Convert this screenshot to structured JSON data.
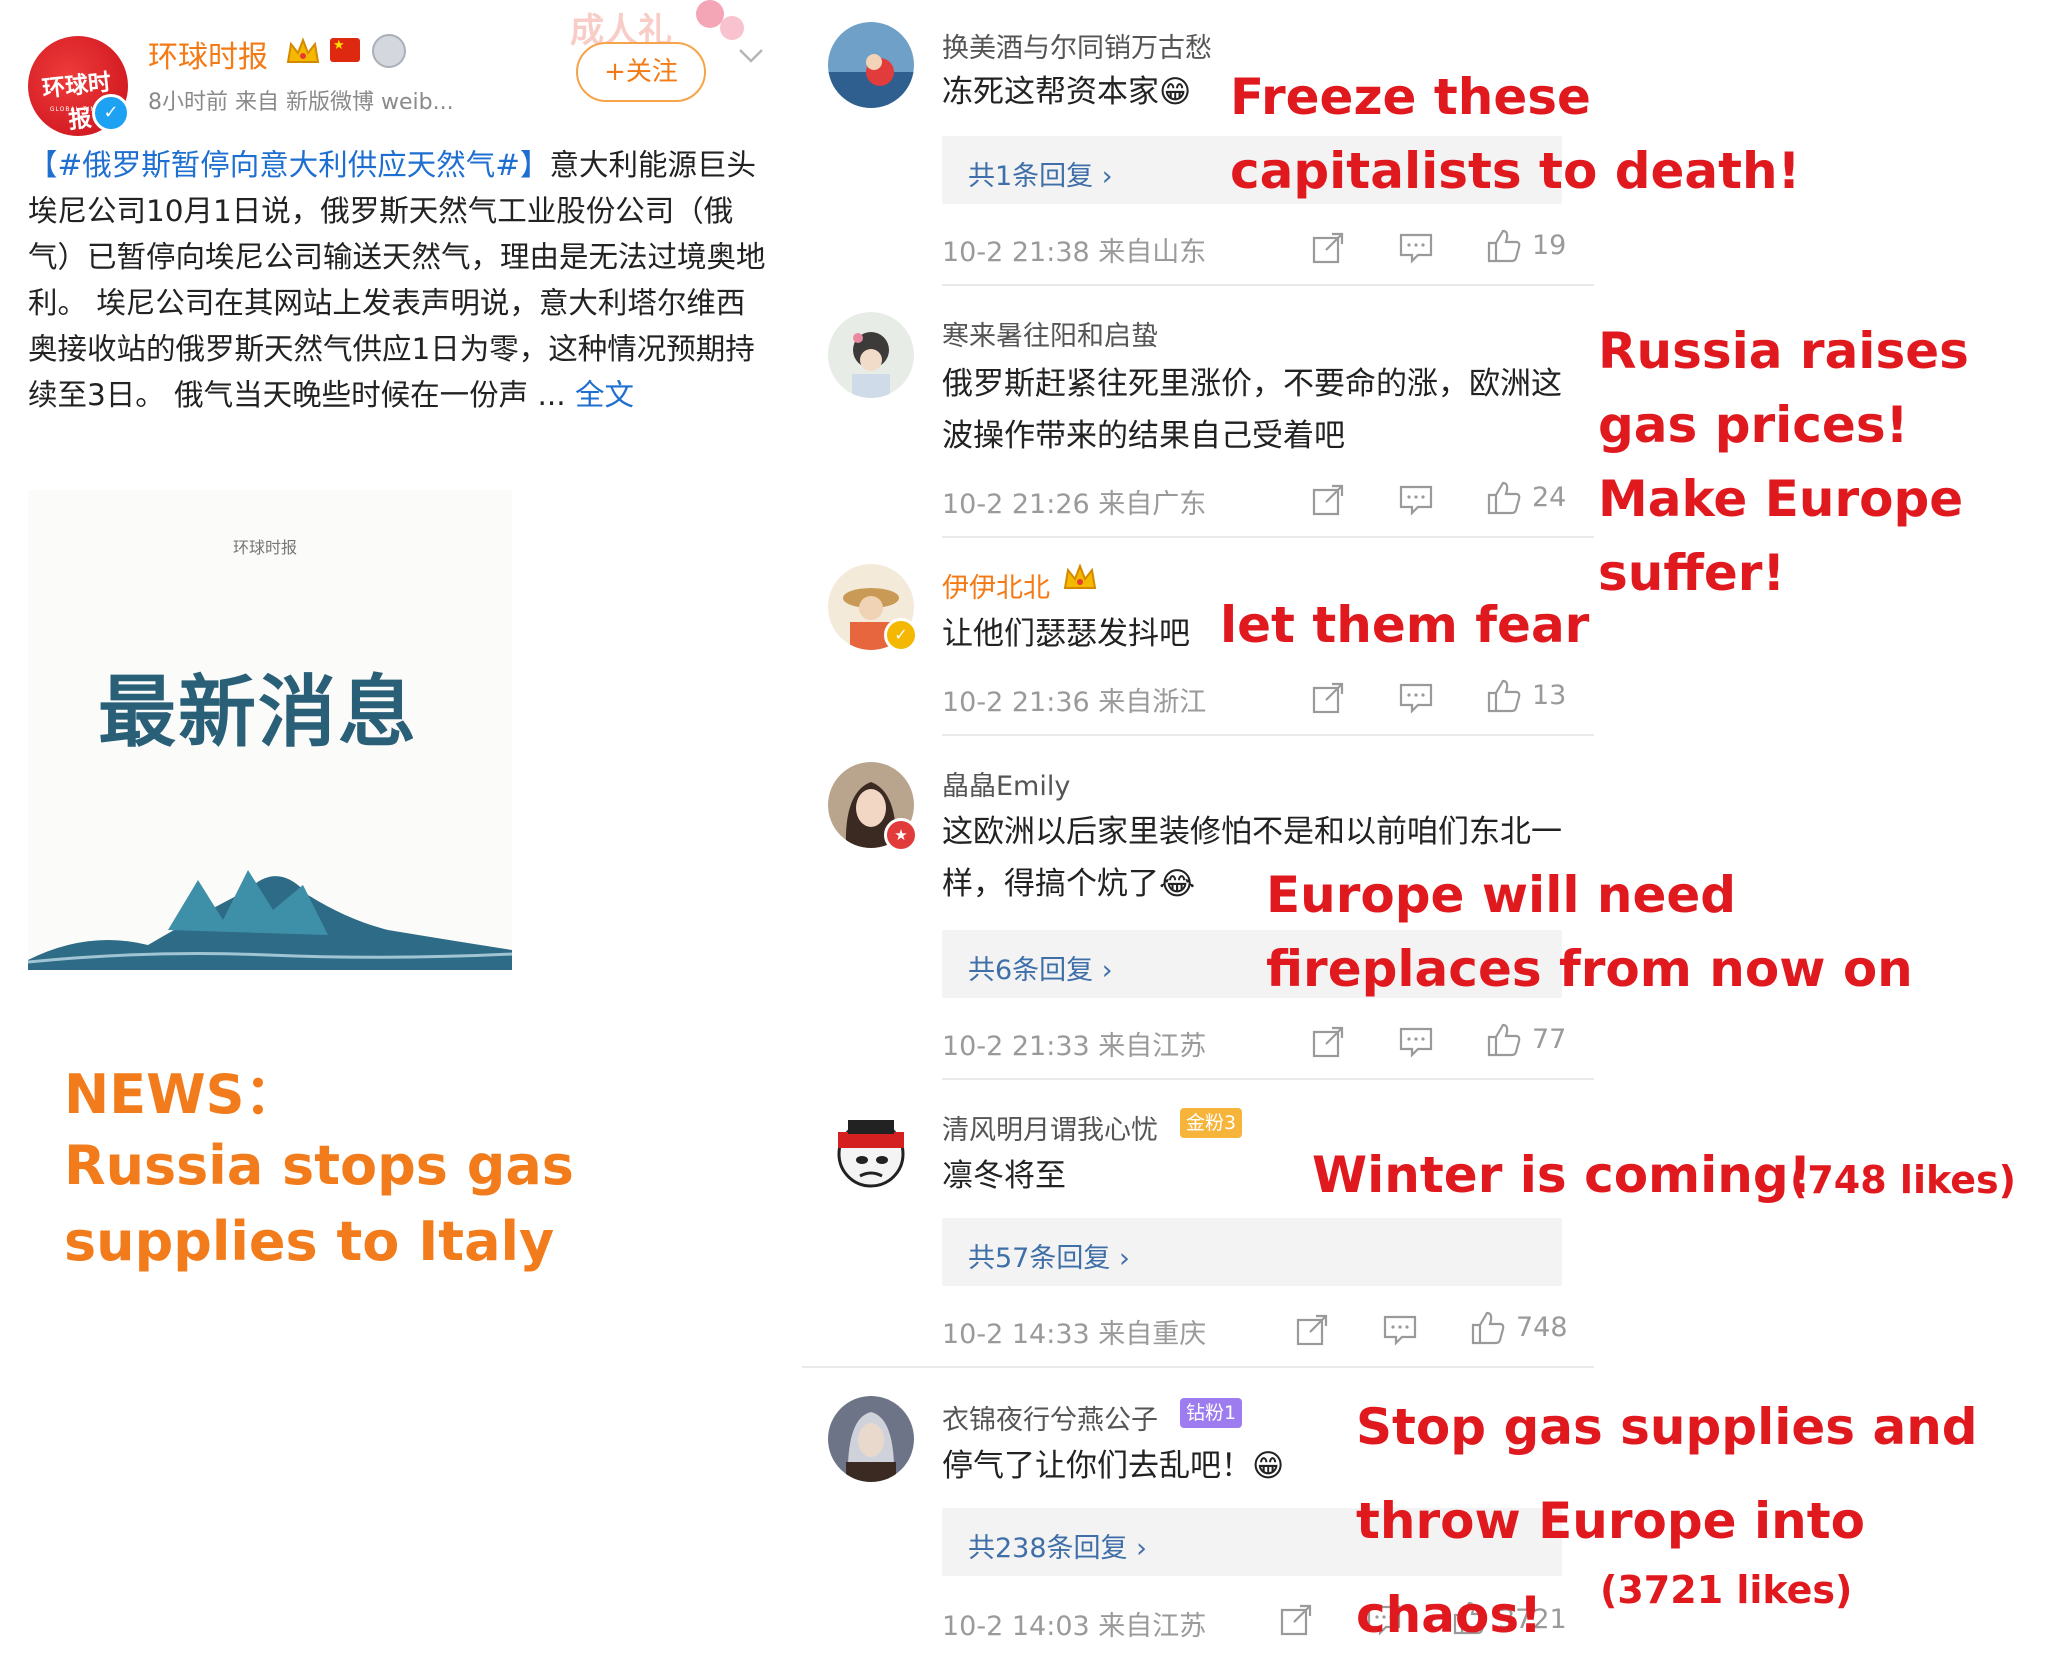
{
  "post": {
    "author": "环球时报",
    "avatar_text": "环球时报",
    "avatar_sub": "GLOBAL TIMES",
    "meta": "8小时前   来自 新版微博 weib...",
    "follow_label": "+关注",
    "hashtag": "【#俄罗斯暂停向意大利供应天然气#】",
    "body": "意大利能源巨头埃尼公司10月1日说，俄罗斯天然气工业股份公司（俄气）已暂停向埃尼公司输送天然气，理由是无法过境奥地利。 埃尼公司在其网站上发表声明说，意大利塔尔维西奥接收站的俄罗斯天然气供应1日为零，这种情况预期持续至3日。 俄气当天晚些时候在一份声 ...",
    "fulltext_link": "全文",
    "image_small_mark": "环球时报",
    "image_headline": "最新消息",
    "news_label": "NEWS：",
    "news_desc": "Russia stops gas supplies to Italy"
  },
  "comments": [
    {
      "user": "换美酒与尔同销万古愁",
      "text": "冻死这帮资本家😁",
      "replies": "共1条回复 ›",
      "time": "10-2 21:38  来自山东",
      "likes": "19",
      "annotation": "Freeze these capitalists to death!"
    },
    {
      "user": "寒来暑往阳和启蛰",
      "text": "俄罗斯赶紧往死里涨价，不要命的涨，欧洲这波操作带来的结果自己受着吧",
      "time": "10-2 21:26  来自广东",
      "likes": "24",
      "annotation": "Russia raises gas prices! Make Europe suffer!"
    },
    {
      "user": "伊伊北北",
      "text": "让他们瑟瑟发抖吧",
      "time": "10-2 21:36  来自浙江",
      "likes": "13",
      "annotation": "let them fear"
    },
    {
      "user": "皛皛Emily",
      "text": "这欧洲以后家里装修怕不是和以前咱们东北一样，得搞个炕了😂",
      "replies": "共6条回复 ›",
      "time": "10-2 21:33  来自江苏",
      "likes": "77",
      "annotation": "Europe will need fireplaces from now on"
    },
    {
      "user": "清风明月谓我心忧",
      "badge": "金粉3",
      "text": "凛冬将至",
      "replies": "共57条回复 ›",
      "time": "10-2 14:33  来自重庆",
      "likes": "748",
      "annotation": "Winter is coming!",
      "annotation_extra": "(748 likes)"
    },
    {
      "user": "衣锦夜行兮燕公子",
      "badge": "钻粉1",
      "text": "停气了让你们去乱吧！😁",
      "replies": "共238条回复 ›",
      "time": "10-2 14:03  来自江苏",
      "likes": "3721",
      "annotation": "Stop gas supplies and throw Europe into chaos!",
      "annotation_extra": "(3721 likes)"
    }
  ],
  "colors": {
    "brand_orange": "#f47a16",
    "annotation_red": "#e0191f",
    "link_blue": "#1f6fd1",
    "reply_blue": "#3f6fa8"
  },
  "icons": [
    "crown-icon",
    "flag-icon",
    "medal-icon",
    "chevron-down-icon",
    "share-icon",
    "comment-icon",
    "like-icon",
    "verified-icon",
    "chevron-right-icon"
  ]
}
